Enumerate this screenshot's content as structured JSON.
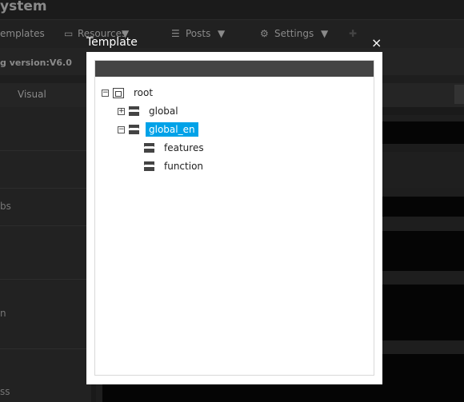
{
  "app": {
    "title": "ystem",
    "version_text": "g version:V6.0"
  },
  "nav": [
    {
      "label": "emplates"
    },
    {
      "label": "Resources",
      "icon": "window-icon"
    },
    {
      "label": "Posts",
      "icon": "list-icon"
    },
    {
      "label": "Settings",
      "icon": "gear-icon"
    }
  ],
  "tabs": {
    "visual": "Visual"
  },
  "sidebar": {
    "items": [
      "bs",
      "n",
      "ss"
    ]
  },
  "dialog": {
    "title": "Template",
    "close": "×",
    "tree": {
      "root": "root",
      "global": "global",
      "global_en": "global_en",
      "features": "features",
      "function": "function"
    },
    "selected": "global_en",
    "accent": "#00a2e8"
  }
}
